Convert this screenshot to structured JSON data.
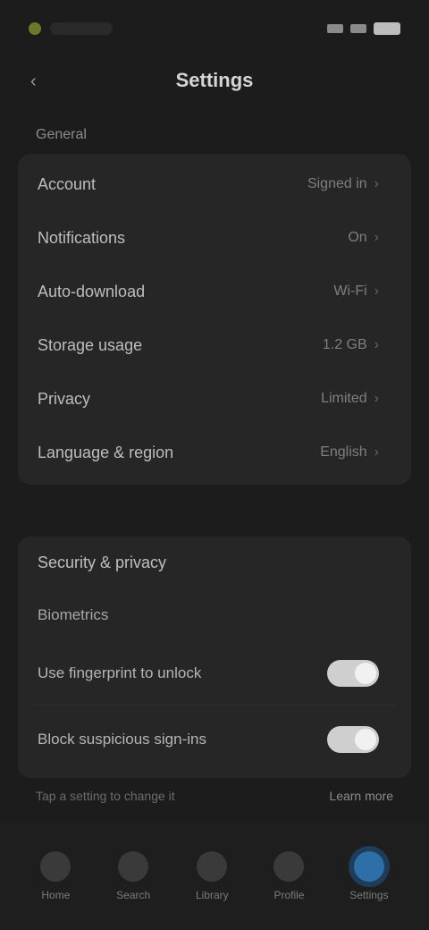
{
  "status": {
    "time": "",
    "carrier": ""
  },
  "header": {
    "title": "Settings",
    "back_icon": "chevron-left-icon"
  },
  "section1": {
    "label": "General",
    "rows": [
      {
        "label": "Account",
        "value": "Signed in"
      },
      {
        "label": "Notifications",
        "value": "On"
      },
      {
        "label": "Auto-download",
        "value": "Wi‑Fi"
      },
      {
        "label": "Storage usage",
        "value": "1.2 GB"
      },
      {
        "label": "Privacy",
        "value": "Limited"
      },
      {
        "label": "Language & region",
        "value": "English"
      }
    ]
  },
  "section2": {
    "label": "Security & privacy",
    "items": [
      {
        "label": "Biometrics"
      },
      {
        "label": "Use fingerprint to unlock",
        "toggle": true
      },
      {
        "label": "Block suspicious sign-ins",
        "toggle": true
      }
    ]
  },
  "tip": {
    "text": "Tap a setting to change it",
    "action": "Learn more"
  },
  "tabs": [
    {
      "label": "Home"
    },
    {
      "label": "Search"
    },
    {
      "label": "Library"
    },
    {
      "label": "Profile"
    },
    {
      "label": "Settings"
    }
  ],
  "colors": {
    "accent": "#2d6fa6"
  }
}
